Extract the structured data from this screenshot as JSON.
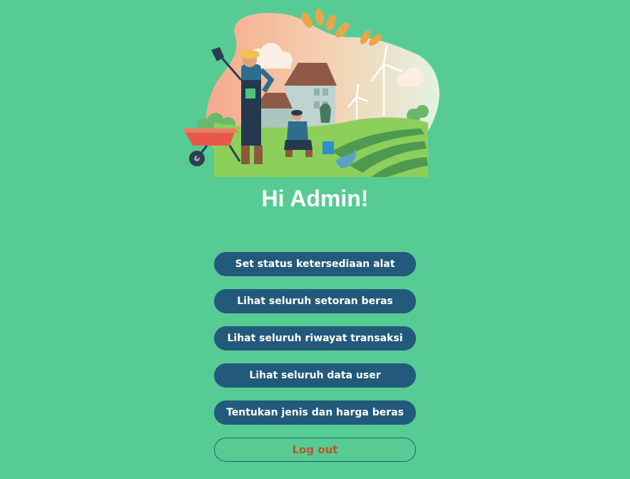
{
  "greeting": "Hi Admin!",
  "menu": {
    "items": [
      {
        "label": "Set status ketersediaan alat"
      },
      {
        "label": "Lihat seluruh setoran beras"
      },
      {
        "label": "Lihat seluruh riwayat transaksi"
      },
      {
        "label": "Lihat seluruh data user"
      },
      {
        "label": "Tentukan jenis dan harga beras"
      }
    ],
    "logout_label": "Log out"
  },
  "illustration": {
    "icon": "farmers-farm-illustration"
  },
  "colors": {
    "background": "#56cc94",
    "button": "#235a7b",
    "button_text": "#ffffff",
    "logout_text": "#c0522c"
  }
}
